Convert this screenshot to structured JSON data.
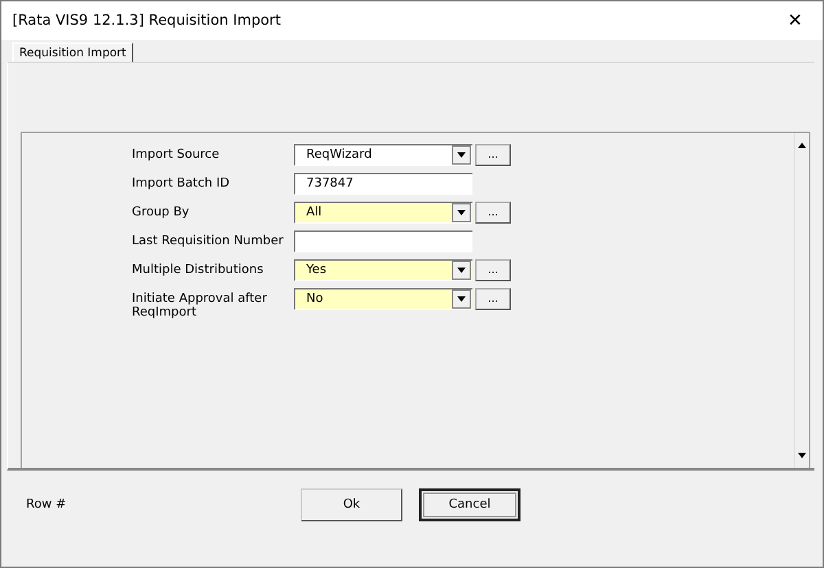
{
  "window": {
    "title": "[Rata VIS9 12.1.3] Requisition Import",
    "close": "✕"
  },
  "tabs": [
    {
      "label": "Requisition Import",
      "selected": true
    }
  ],
  "form": [
    {
      "label": "Import Source",
      "kind": "combo",
      "value": "ReqWizard",
      "highlighted": false,
      "lookup": "..."
    },
    {
      "label": "Import Batch ID",
      "kind": "text",
      "value": "737847",
      "highlighted": false
    },
    {
      "label": "Group By",
      "kind": "combo",
      "value": "All",
      "highlighted": true,
      "lookup": "..."
    },
    {
      "label": "Last Requisition Number",
      "kind": "text",
      "highlighted": false
    },
    {
      "label": "Multiple Distributions",
      "kind": "combo",
      "value": "Yes",
      "highlighted": true,
      "lookup": "..."
    },
    {
      "label": "Initiate Approval after ReqImport",
      "kind": "combo",
      "value": "No",
      "highlighted": true,
      "lookup": "..."
    }
  ],
  "status": {
    "label": "Row #"
  },
  "buttons": [
    {
      "label": "Ok",
      "default": false
    },
    {
      "label": "Cancel",
      "default": true
    }
  ]
}
